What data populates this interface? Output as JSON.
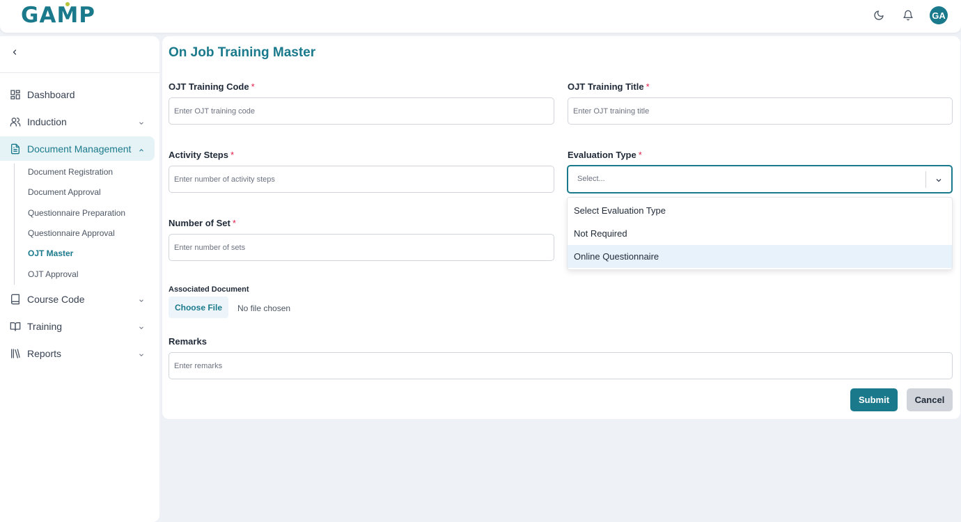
{
  "app": {
    "logo_text": "GAMP",
    "user_initials": "GA",
    "accent": "#1a7a8c",
    "logo_dot": "#b6c53a"
  },
  "topbar": {
    "icons": [
      "moon-icon",
      "bell-icon"
    ]
  },
  "sidebar": {
    "items": [
      {
        "label": "Dashboard",
        "icon": "dashboard-icon"
      },
      {
        "label": "Induction",
        "icon": "users-icon"
      },
      {
        "label": "Document Management",
        "icon": "document-icon"
      },
      {
        "label": "Course Code",
        "icon": "book-icon"
      },
      {
        "label": "Training",
        "icon": "open-book-icon"
      },
      {
        "label": "Reports",
        "icon": "library-icon"
      }
    ],
    "sub_items": [
      {
        "label": "Document Registration"
      },
      {
        "label": "Document Approval"
      },
      {
        "label": "Questionnaire Preparation"
      },
      {
        "label": "Questionnaire Approval"
      },
      {
        "label": "OJT Master"
      },
      {
        "label": "OJT Approval"
      }
    ]
  },
  "form": {
    "title": "On Job Training Master",
    "required_mark": "*",
    "training_code": {
      "label": "OJT Training Code",
      "placeholder": "Enter OJT training code"
    },
    "training_title": {
      "label": "OJT Training Title",
      "placeholder": "Enter OJT training title"
    },
    "activity_steps": {
      "label": "Activity Steps",
      "placeholder": "Enter number of activity steps"
    },
    "evaluation_type": {
      "label": "Evaluation Type",
      "placeholder": "Select...",
      "options": [
        "Select Evaluation Type",
        "Not Required",
        "Online Questionnaire"
      ]
    },
    "number_of_set": {
      "label": "Number of Set",
      "placeholder": "Enter number of sets"
    },
    "associated_document": {
      "label": "Associated Document",
      "button": "Choose File",
      "status": "No file chosen"
    },
    "remarks": {
      "label": "Remarks",
      "placeholder": "Enter remarks"
    },
    "submit_label": "Submit",
    "cancel_label": "Cancel"
  }
}
